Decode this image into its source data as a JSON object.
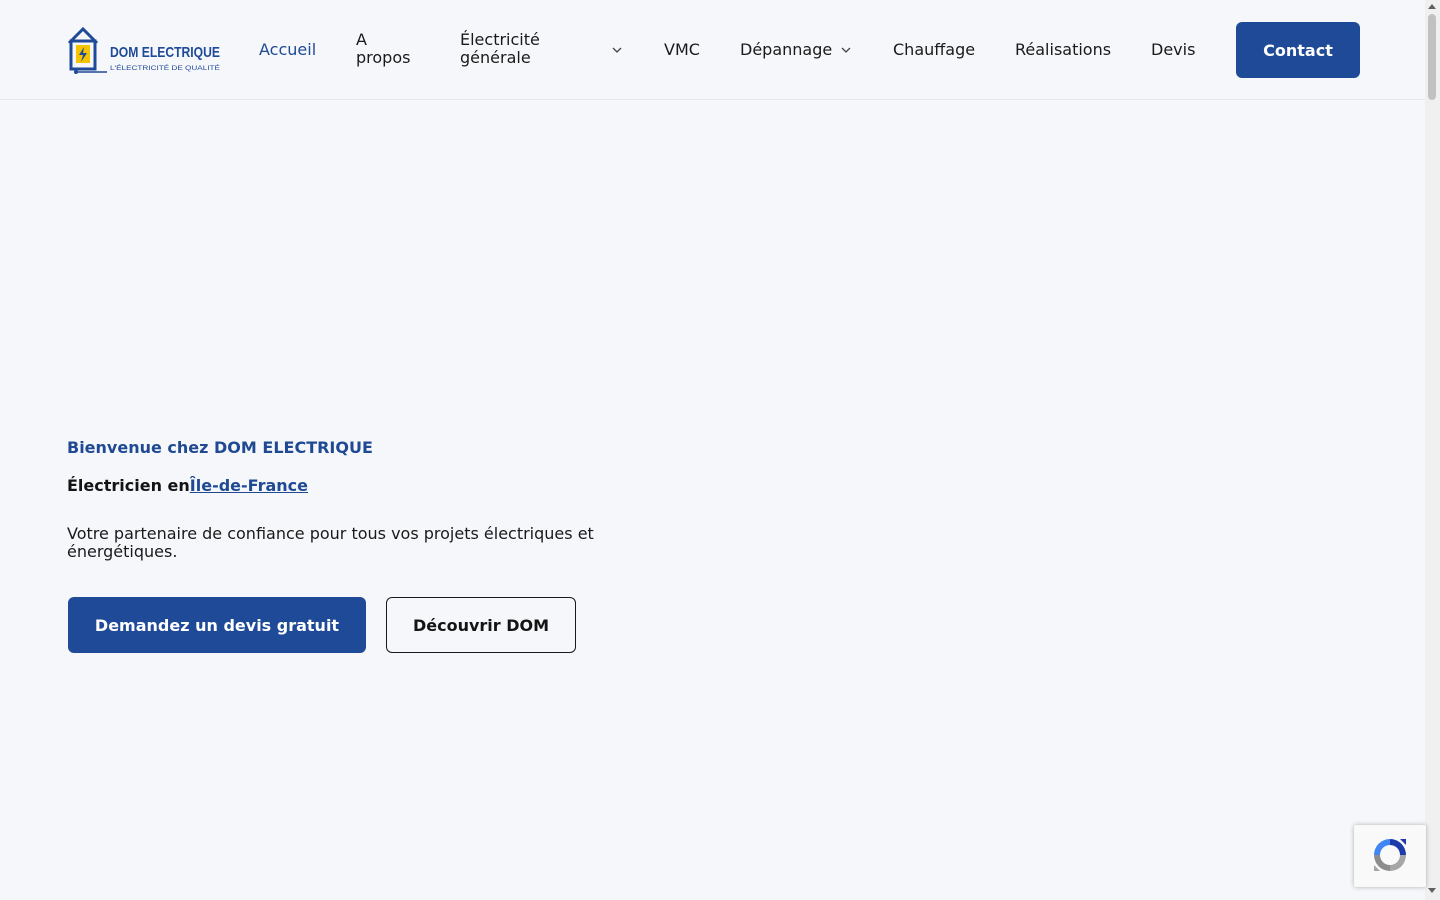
{
  "brand": {
    "logo_name": "DOM ELECTRIQUE",
    "logo_tagline": "L'ÉLECTRICITÉ DE QUALITÉ"
  },
  "nav": {
    "items": [
      {
        "label": "Accueil",
        "active": true
      },
      {
        "label": "A propos"
      },
      {
        "label": "Électricité générale",
        "has_dropdown": true
      },
      {
        "label": "VMC"
      },
      {
        "label": "Dépannage",
        "has_dropdown": true
      },
      {
        "label": "Chauffage"
      },
      {
        "label": "Réalisations"
      },
      {
        "label": "Devis"
      }
    ],
    "contact_label": "Contact"
  },
  "hero": {
    "kicker": "Bienvenue chez DOM ELECTRIQUE",
    "headline_prefix": "Électricien en",
    "headline_link": "Île-de-France",
    "description": "Votre partenaire de confiance pour tous vos projets électriques et énergétiques.",
    "primary_button": "Demandez un devis gratuit",
    "secondary_button": "Découvrir DOM"
  },
  "colors": {
    "brand_blue": "#1f4a98",
    "accent_yellow": "#f5c400",
    "background": "#f5f7fb"
  },
  "icons": {
    "recaptcha": "recaptcha-icon",
    "dropdown": "chevron-down-icon"
  }
}
